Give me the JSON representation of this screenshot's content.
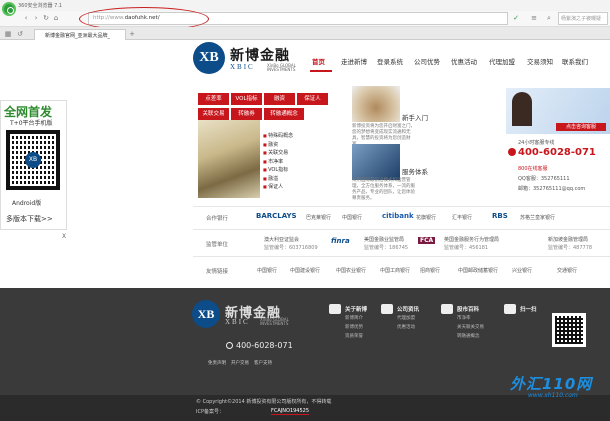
{
  "browser": {
    "window_title": "360安全浏览器 7.1",
    "url_prefix": "http://www.",
    "url_host": "daofuhk.net/",
    "search_placeholder": "杨紫演之子被曝疑",
    "tab_label": "新博金融官网_亚洲最大品牌_"
  },
  "site": {
    "brand_cn": "新博金融",
    "brand_en": "XBIC",
    "brand_sub": "XinBo GLOBAL INVESTMENTS",
    "logo_letters": "XB",
    "nav": [
      "首页",
      "走进新博",
      "登录系统",
      "公司优势",
      "优惠活动",
      "代理加盟",
      "交易须知",
      "联系我们"
    ]
  },
  "ad": {
    "title": "全网首发",
    "subtitle": "T+0平台手机版",
    "platform": "Android版",
    "download": "多版本下载>>",
    "close": "X"
  },
  "red_grid": [
    [
      "点差率",
      "VOL指标",
      "融资",
      "保证人"
    ],
    [
      "关联交易",
      "转融券",
      "转融通概念"
    ]
  ],
  "feature_list": [
    "特殊码概念",
    "融资",
    "关联交易",
    "市净率",
    "VOL指标",
    "融溢",
    "保证人"
  ],
  "middle": [
    {
      "title": "新手入门",
      "text": "新博投资将为您开启财富之门，您的梦想将变成现实流通和无具，智慧的投资将为您创造财富。"
    },
    {
      "title": "服务体系",
      "text": "采用国际最前沿模式和运营管理，全方位服务体系，一流的服务产品，专业的团队，让您体验尊贵服务。"
    }
  ],
  "contact": {
    "button": "点击咨询客服",
    "hours": "24小时客服专线",
    "phone": "400-6028-071",
    "tel_label": "800在线客服",
    "qq": "QQ客服：352765111",
    "email": "邮箱：352765111@qq.com"
  },
  "partners": {
    "label_bank": "合作银行",
    "label_reg": "监管单位",
    "label_links": "友情链接",
    "banks": [
      "BARCLAYS",
      "巴克莱银行",
      "中国银行",
      "citibank",
      "花旗银行",
      "汇丰银行",
      "RBS",
      "苏格兰皇家银行"
    ],
    "regulators": [
      "澳大利亚证监会",
      "监管编号：603716809",
      "finra",
      "美国金融业监管局",
      "监管编号：186745",
      "FCA",
      "英国金融服务行为管理局",
      "监管编号：456181",
      "新加坡金融管理局",
      "监管编号：487778"
    ],
    "links": [
      "中国银行",
      "中国建设银行",
      "中国农业银行",
      "中国工商银行",
      "招商银行",
      "中国邮政储蓄银行",
      "兴业银行",
      "交通银行"
    ]
  },
  "footer": {
    "phone": "400-6028-071",
    "links": [
      "免责声明",
      "开户交易",
      "客户支持"
    ],
    "cols": [
      {
        "head": "关于新博",
        "items": [
          "新博简介",
          "新博优势",
          "资质荣誉"
        ]
      },
      {
        "head": "公司资讯",
        "items": [
          "代理加盟",
          "优惠活动"
        ]
      },
      {
        "head": "股市百科",
        "items": [
          "市净率",
          "关天联关交易",
          "转融通概念"
        ]
      },
      {
        "head": "扫一扫",
        "items": []
      }
    ],
    "copyright": "© Copyright©2014 新博投资有限公司版权所有，不得转载",
    "icp_label": "ICP备案号：",
    "icp_number": "FCAJNO194525"
  },
  "watermark": {
    "text": "外汇110网",
    "url": "www.xh110.com"
  },
  "colors": {
    "accent": "#c8161d",
    "brand": "#0c4c89",
    "footer": "#3a3a3a"
  }
}
